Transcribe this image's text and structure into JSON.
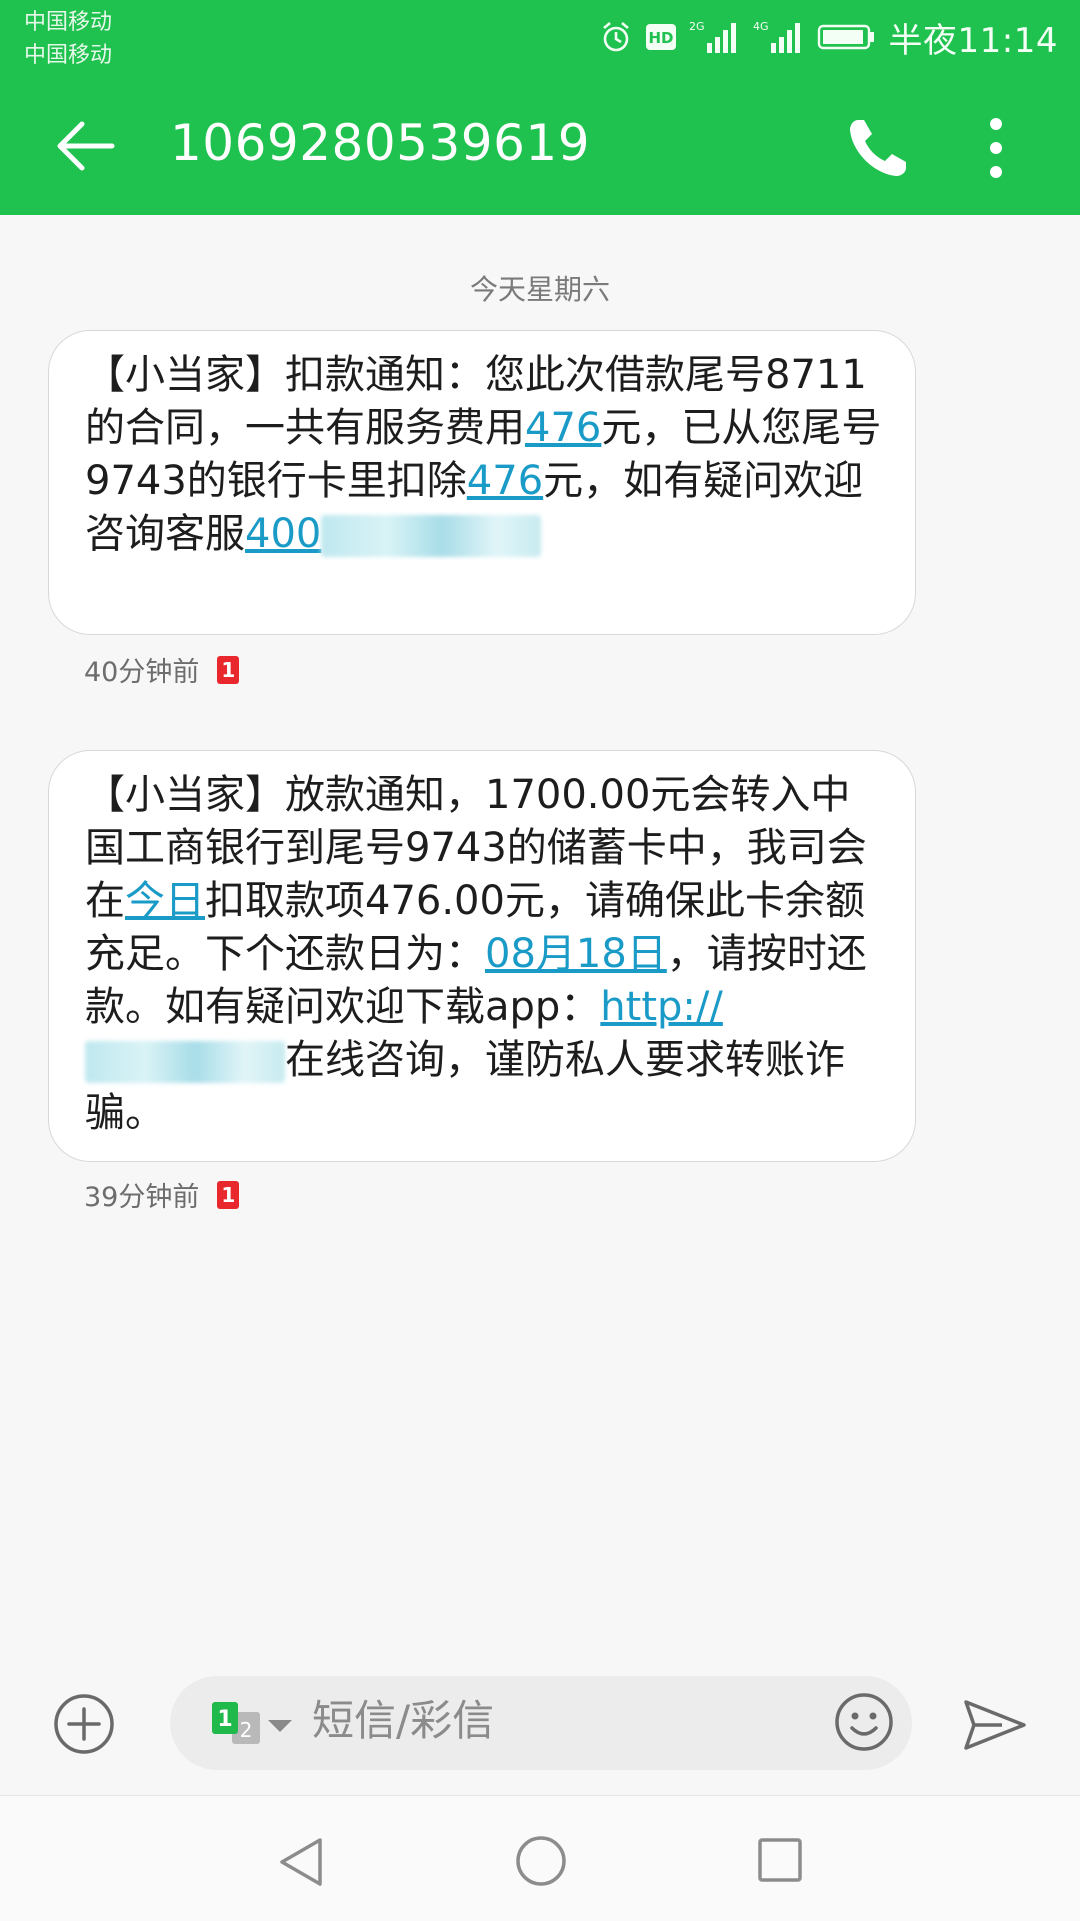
{
  "status_bar": {
    "carrier_1": "中国移动",
    "carrier_2": "中国移动",
    "hd_label": "HD",
    "net_2g": "2G",
    "net_4g": "4G",
    "time": "半夜11:14"
  },
  "header": {
    "title": "1069280539619",
    "background_color": "#1fc14f"
  },
  "date_separator": "今天星期六",
  "messages": [
    {
      "parts": [
        "【小当家】扣款通知：您此次借款尾号8711的合同，一共有服务费用",
        "476",
        "元，已从您尾号9743的银行卡里扣除",
        "476",
        "元，如有疑问欢迎咨询客服",
        "400"
      ],
      "time": "40分钟前",
      "sim": "1"
    },
    {
      "parts": [
        "【小当家】放款通知，1700.00元会转入中国工商银行到尾号9743的储蓄卡中，我司会在",
        "今日",
        "扣取款项476.00元，请确保此卡余额充足。下个还款日为：",
        "08月18日",
        "，请按时还款。如有疑问欢迎下载app：",
        "http://",
        "在线咨询，谨防私人要求转账诈骗。"
      ],
      "time": "39分钟前",
      "sim": "1"
    }
  ],
  "composer": {
    "placeholder": "短信/彩信",
    "sim_primary": "1",
    "sim_secondary": "2"
  },
  "colors": {
    "link": "#1a9bc7",
    "sim_badge": "#e8282d"
  }
}
